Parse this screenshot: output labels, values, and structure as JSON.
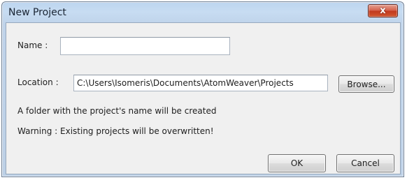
{
  "window": {
    "title": "New Project",
    "close_label": "x"
  },
  "form": {
    "name_label": "Name :",
    "name_value": "",
    "location_label": "Location :",
    "location_value": "C:\\Users\\Isomeris\\Documents\\AtomWeaver\\Projects",
    "browse_label": "Browse...",
    "info_text": "A folder with the project's name will be created",
    "warning_text": "Warning : Existing projects will be overwritten!"
  },
  "buttons": {
    "ok_label": "OK",
    "cancel_label": "Cancel"
  }
}
